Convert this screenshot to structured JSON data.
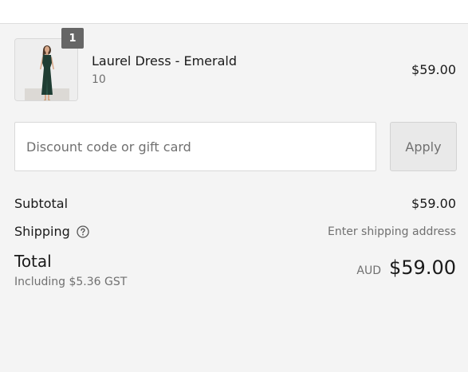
{
  "order": {
    "item": {
      "name": "Laurel Dress - Emerald",
      "variant": "10",
      "price": "$59.00",
      "quantity": "1",
      "image": "product-photo-woman-in-green-dress"
    },
    "discount": {
      "placeholder": "Discount code or gift card",
      "apply_label": "Apply"
    },
    "subtotal": {
      "label": "Subtotal",
      "value": "$59.00"
    },
    "shipping": {
      "label": "Shipping",
      "value": "Enter shipping address",
      "icon": "question-circle-icon"
    },
    "total": {
      "label": "Total",
      "tax_note": "Including $5.36 GST",
      "currency": "AUD",
      "amount": "$59.00"
    }
  },
  "colors": {
    "background": "#f4f4f4",
    "badge": "#666666",
    "muted_text": "#707070",
    "dress": "#1f3d33"
  }
}
